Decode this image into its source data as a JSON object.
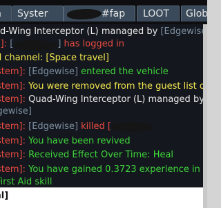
{
  "tabs": [
    {
      "label": "n"
    },
    {
      "label": "Syster"
    },
    {
      "label": "#fap"
    },
    {
      "label": "LOOT"
    },
    {
      "label": "Glob"
    }
  ],
  "chat_lines": [
    {
      "parts": [
        {
          "text": "d-Wing Interceptor (L) managed by ",
          "color": "white"
        },
        {
          "text": "[Edgewise]",
          "color": "grey"
        }
      ]
    },
    {
      "parts": [
        {
          "text": "em]: ",
          "color": "red"
        },
        {
          "text": "[",
          "color": "grey"
        },
        {
          "text": "]",
          "color": "grey"
        },
        {
          "text": " has logged in",
          "color": "red"
        }
      ]
    },
    {
      "parts": [
        {
          "text": "d channel: [Space travel]",
          "color": "yellow"
        }
      ]
    },
    {
      "parts": [
        {
          "text": "[System]: ",
          "color": "red"
        },
        {
          "text": "[Edgewise]",
          "color": "grey"
        },
        {
          "text": " entered the vehicle",
          "color": "green"
        }
      ]
    },
    {
      "parts": [
        {
          "text": "[System]: ",
          "color": "red"
        },
        {
          "text": "You were removed from the guest list o",
          "color": "yellow"
        }
      ]
    },
    {
      "parts": [
        {
          "text": "[System]: ",
          "color": "red"
        },
        {
          "text": "Quad-Wing Interceptor (L) managed by",
          "color": "white"
        }
      ]
    },
    {
      "parts": [
        {
          "text": "[Edgewise]",
          "color": "grey"
        }
      ]
    },
    {
      "parts": [
        {
          "text": "[System]: ",
          "color": "red"
        },
        {
          "text": "[Edgewise]",
          "color": "grey"
        },
        {
          "text": " killed [",
          "color": "red"
        }
      ]
    },
    {
      "parts": [
        {
          "text": "[System]: ",
          "color": "red"
        },
        {
          "text": "You have been revived",
          "color": "green"
        }
      ]
    },
    {
      "parts": [
        {
          "text": "[System]: ",
          "color": "red"
        },
        {
          "text": "Received Effect Over Time: Heal",
          "color": "green"
        }
      ]
    },
    {
      "parts": [
        {
          "text": "[System]: ",
          "color": "red"
        },
        {
          "text": "You have gained 0.3723 experience in",
          "color": "green"
        }
      ]
    },
    {
      "parts": [
        {
          "text": "First Aid skill",
          "color": "green"
        }
      ]
    }
  ],
  "input": {
    "label": "al]"
  },
  "colors": {
    "red": "#ec4a42",
    "white": "#e8e8e8",
    "green": "#3fd63a",
    "yellow": "#f2e64e",
    "grey": "#7e8fa2"
  }
}
